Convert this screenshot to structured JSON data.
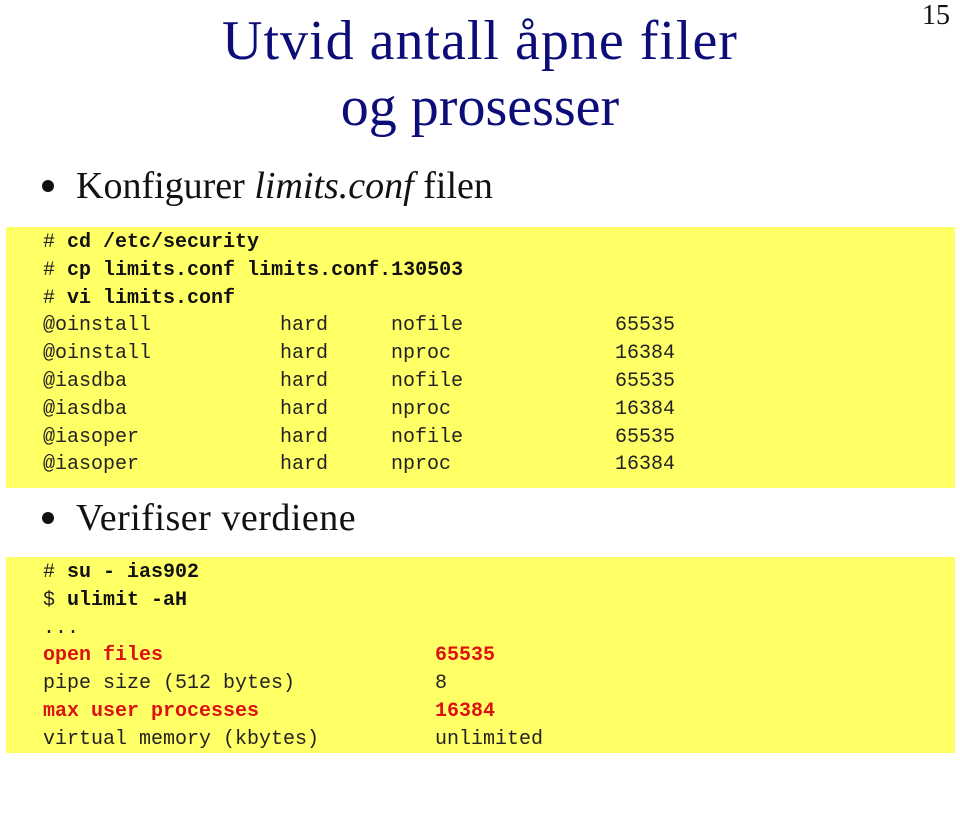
{
  "page_number": "15",
  "title": {
    "line1": "Utvid antall åpne filer",
    "line2": "og prosesser"
  },
  "bullets": [
    {
      "text_before": "Konfigurer ",
      "italic": "limits.conf",
      "text_after": " filen"
    },
    {
      "text": "Verifiser verdiene"
    }
  ],
  "config_box": {
    "commands": [
      {
        "prompt": "#",
        "command": "cd /etc/security"
      },
      {
        "prompt": "#",
        "command": "cp limits.conf limits.conf.130503"
      },
      {
        "prompt": "#",
        "command": "vi limits.conf"
      }
    ],
    "limits": [
      {
        "domain": "@oinstall",
        "type": "hard",
        "item": "nofile",
        "value": "65535"
      },
      {
        "domain": "@oinstall",
        "type": "hard",
        "item": "nproc",
        "value": "16384"
      },
      {
        "domain": "@iasdba",
        "type": "hard",
        "item": "nofile",
        "value": "65535"
      },
      {
        "domain": "@iasdba",
        "type": "hard",
        "item": "nproc",
        "value": "16384"
      },
      {
        "domain": "@iasoper",
        "type": "hard",
        "item": "nofile",
        "value": "65535"
      },
      {
        "domain": "@iasoper",
        "type": "hard",
        "item": "nproc",
        "value": "16384"
      }
    ]
  },
  "verify_box": {
    "commands": [
      {
        "prompt": "#",
        "command": "su - ias902"
      },
      {
        "prompt": "$",
        "command": "ulimit -aH"
      }
    ],
    "ellipsis": "...",
    "output": [
      {
        "label": "open files",
        "value": "65535",
        "highlight": true
      },
      {
        "label": "pipe size (512 bytes)",
        "value": "8",
        "highlight": false
      },
      {
        "label": "max user processes",
        "value": "16384",
        "highlight": true
      },
      {
        "label": "virtual memory (kbytes)",
        "value": "unlimited",
        "highlight": false
      }
    ]
  },
  "colors": {
    "title": "#0d0d7a",
    "code_background": "#ffff66",
    "highlight": "#dd1111"
  }
}
